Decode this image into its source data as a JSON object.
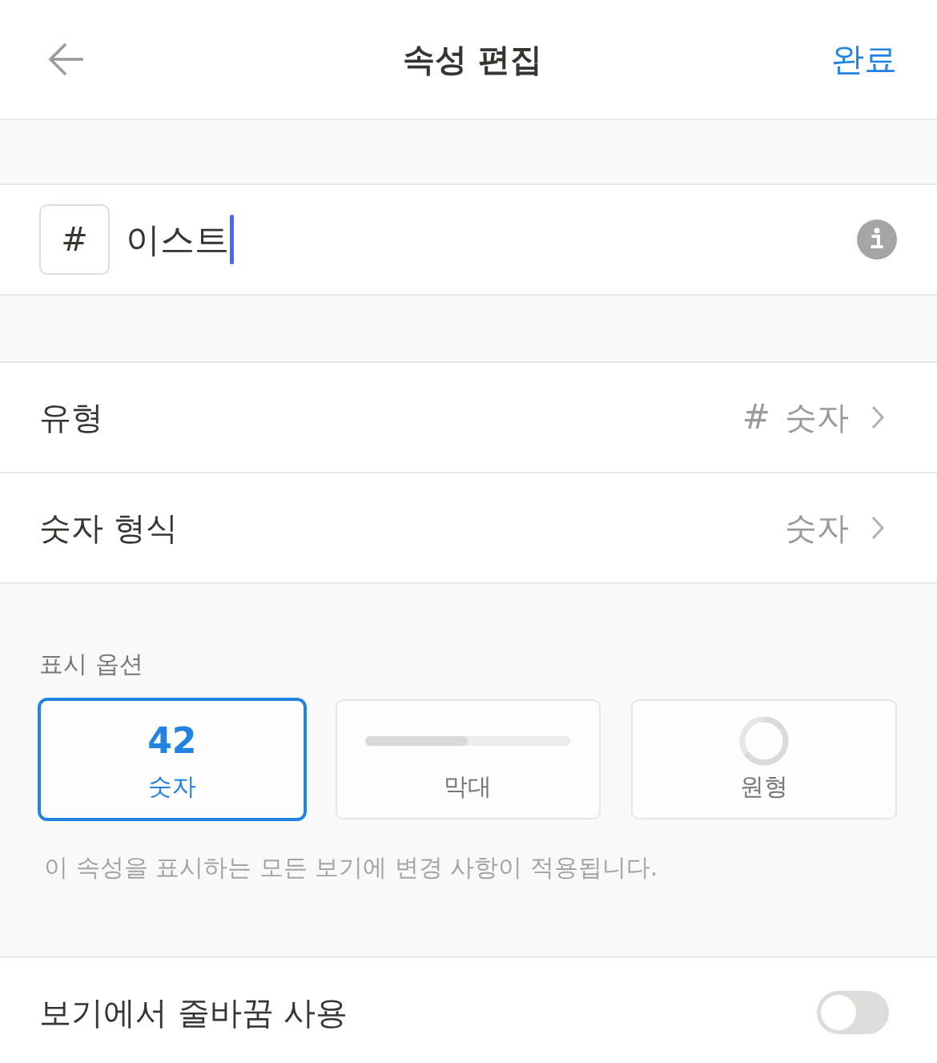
{
  "header": {
    "title": "속성 편집",
    "done": "완료"
  },
  "name_field": {
    "icon": "#",
    "value": "이스트",
    "focused": true
  },
  "rows": [
    {
      "label": "유형",
      "glyph": "#",
      "value": "숫자"
    },
    {
      "label": "숫자 형식",
      "value": "숫자"
    }
  ],
  "display_options": {
    "heading": "표시 옵션",
    "options": [
      {
        "kind": "number",
        "preview": "42",
        "label": "숫자",
        "selected": true
      },
      {
        "kind": "bar",
        "label": "막대",
        "selected": false
      },
      {
        "kind": "ring",
        "label": "원형",
        "selected": false
      }
    ],
    "note": "이 속성을 표시하는 모든 보기에 변경 사항이 적용됩니다."
  },
  "wrap_setting": {
    "label": "보기에서 줄바꿈 사용",
    "on": false
  }
}
